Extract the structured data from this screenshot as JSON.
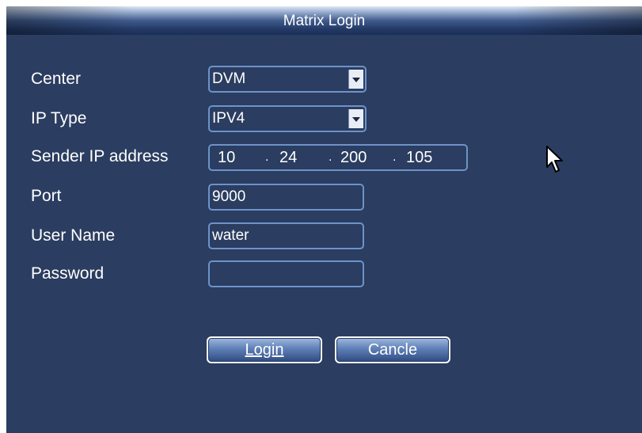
{
  "dialog": {
    "title": "Matrix Login"
  },
  "form": {
    "center": {
      "label": "Center",
      "value": "DVM"
    },
    "ip_type": {
      "label": "IP Type",
      "value": "IPV4"
    },
    "sender_ip": {
      "label": "Sender IP address",
      "octets": [
        "10",
        "24",
        "200",
        "105"
      ]
    },
    "port": {
      "label": "Port",
      "value": "9000"
    },
    "user_name": {
      "label": "User Name",
      "value": "water"
    },
    "password": {
      "label": "Password",
      "value": ""
    }
  },
  "buttons": {
    "login": "Login",
    "cancel": "Cancle"
  },
  "icons": {
    "dropdown": "chevron-down-icon",
    "pointer": "mouse-pointer-icon"
  },
  "colors": {
    "background": "#2b3d60",
    "field_border": "#6d93c9",
    "text": "#ffffff"
  }
}
